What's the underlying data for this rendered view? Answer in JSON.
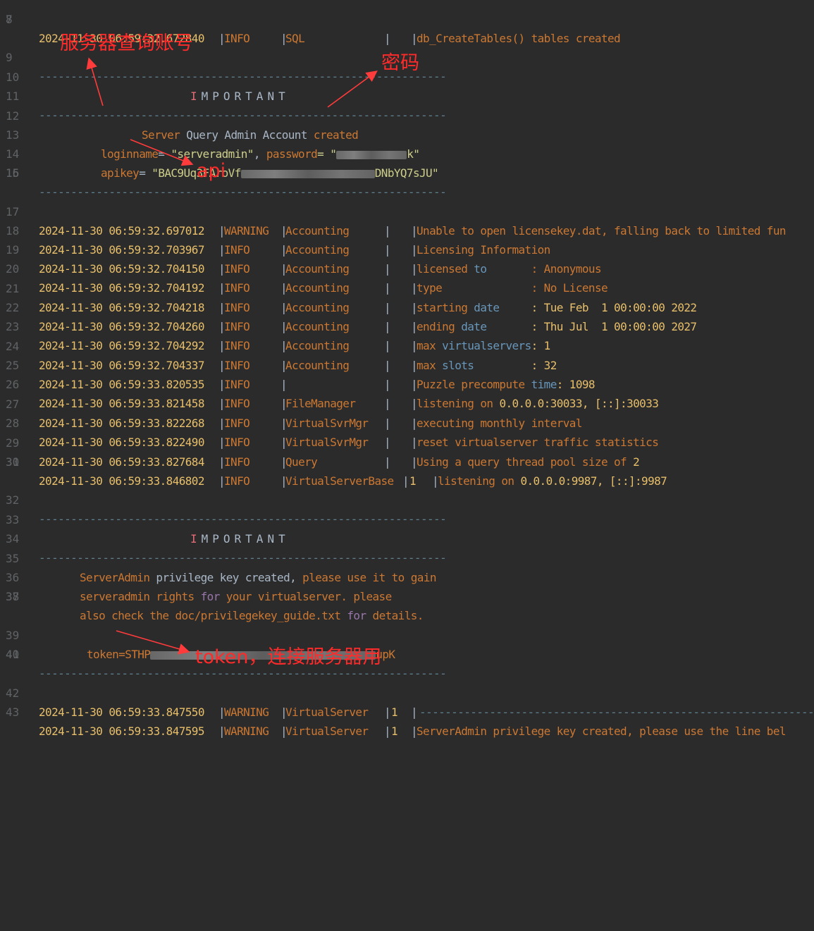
{
  "lines": {
    "l7": {
      "num": "7",
      "ts": "2024-11-30 06:59:32.672840",
      "lv": "INFO",
      "mod": "SQL",
      "msg": "db_CreateTables() tables created"
    },
    "l8": {
      "num": "8"
    },
    "l9": {
      "num": "9",
      "sep": "----------------------------------------------------------------"
    },
    "l10": {
      "num": "10",
      "important_first": "I",
      "important_rest": "MPORTANT"
    },
    "l11": {
      "num": "11",
      "sep": "----------------------------------------------------------------"
    },
    "l12": {
      "num": "12",
      "a": "Server",
      "b": " Query Admin Account ",
      "c": "created"
    },
    "l13": {
      "num": "13",
      "a": "loginname",
      "b": "= ",
      "c": "\"serveradmin\"",
      "d": ", ",
      "e": "password",
      "f": "= \"",
      "g": "k\""
    },
    "l14": {
      "num": "14",
      "a": "apikey",
      "b": "= ",
      "c": "\"BAC9Uq3FAroVf",
      "d": "DNbYQ7sJU\""
    },
    "l15": {
      "num": "15",
      "sep": "----------------------------------------------------------------"
    },
    "l16": {
      "num": "16"
    },
    "l17": {
      "num": "17",
      "ts": "2024-11-30 06:59:32.697012",
      "lv": "WARNING",
      "mod": "Accounting",
      "msg": "Unable to open licensekey.dat, falling back to limited fun"
    },
    "l18": {
      "num": "18",
      "ts": "2024-11-30 06:59:32.703967",
      "lv": "INFO",
      "mod": "Accounting",
      "msg": "Licensing Information"
    },
    "l19": {
      "num": "19",
      "ts": "2024-11-30 06:59:32.704150",
      "lv": "INFO",
      "mod": "Accounting",
      "k1": "licensed ",
      "k2": "to",
      "pad": "       ",
      "val": ": Anonymous"
    },
    "l20": {
      "num": "20",
      "ts": "2024-11-30 06:59:32.704192",
      "lv": "INFO",
      "mod": "Accounting",
      "k1": "type",
      "k2": "",
      "pad": "              ",
      "val": ": No License"
    },
    "l21": {
      "num": "21",
      "ts": "2024-11-30 06:59:32.704218",
      "lv": "INFO",
      "mod": "Accounting",
      "k1": "starting ",
      "k2": "date",
      "pad": "     ",
      "val": ": Tue Feb  1 00:00:00 2022"
    },
    "l22": {
      "num": "22",
      "ts": "2024-11-30 06:59:32.704260",
      "lv": "INFO",
      "mod": "Accounting",
      "k1": "ending ",
      "k2": "date",
      "pad": "       ",
      "val": ": Thu Jul  1 00:00:00 2027"
    },
    "l23": {
      "num": "23",
      "ts": "2024-11-30 06:59:32.704292",
      "lv": "INFO",
      "mod": "Accounting",
      "k1": "max ",
      "k2": "virtualservers",
      "pad": "",
      "val": ": 1"
    },
    "l24": {
      "num": "24",
      "ts": "2024-11-30 06:59:32.704337",
      "lv": "INFO",
      "mod": "Accounting",
      "k1": "max ",
      "k2": "slots",
      "pad": "         ",
      "val": ": 32"
    },
    "l25": {
      "num": "25",
      "ts": "2024-11-30 06:59:33.820535",
      "lv": "INFO",
      "mod": "",
      "m1": "Puzzle precompute ",
      "m2": "time",
      "m3": ": 1098"
    },
    "l26": {
      "num": "26",
      "ts": "2024-11-30 06:59:33.821458",
      "lv": "INFO",
      "mod": "FileManager",
      "m1": "listening on ",
      "m2": "0.0.0.0:30033, [::]:30033"
    },
    "l27": {
      "num": "27",
      "ts": "2024-11-30 06:59:33.822268",
      "lv": "INFO",
      "mod": "VirtualSvrMgr",
      "msg": "executing monthly interval"
    },
    "l28": {
      "num": "28",
      "ts": "2024-11-30 06:59:33.822490",
      "lv": "INFO",
      "mod": "VirtualSvrMgr",
      "msg": "reset virtualserver traffic statistics"
    },
    "l29": {
      "num": "29",
      "ts": "2024-11-30 06:59:33.827684",
      "lv": "INFO",
      "mod": "Query",
      "m1": "Using a query thread pool size of ",
      "m2": "2"
    },
    "l30": {
      "num": "30",
      "ts": "2024-11-30 06:59:33.846802",
      "lv": "INFO",
      "mod": "VirtualServerBase",
      "sid": "1",
      "m1": "listening on ",
      "m2": "0.0.0.0:9987, [::]:9987"
    },
    "l31": {
      "num": "31"
    },
    "l32": {
      "num": "32",
      "sep": "----------------------------------------------------------------"
    },
    "l33": {
      "num": "33",
      "important_first": "I",
      "important_rest": "MPORTANT"
    },
    "l34": {
      "num": "34",
      "sep": "----------------------------------------------------------------"
    },
    "l35": {
      "num": "35",
      "a": "ServerAdmin",
      "b": " privilege key created, ",
      "c": "please use it to gain"
    },
    "l36": {
      "num": "36",
      "a": "serveradmin rights ",
      "b": "for",
      "c": " your virtualserver. please"
    },
    "l37": {
      "num": "37",
      "a": "also check the doc/privilegekey_guide.txt ",
      "b": "for",
      "c": " details."
    },
    "l38": {
      "num": "38"
    },
    "l39": {
      "num": "39",
      "a": "token=STHP",
      "b": "upK"
    },
    "l40": {
      "num": "40",
      "sep": "----------------------------------------------------------------"
    },
    "l41": {
      "num": "41"
    },
    "l42": {
      "num": "42",
      "ts": "2024-11-30 06:59:33.847550",
      "lv": "WARNING",
      "mod": "VirtualServer",
      "sid": "1",
      "sep": "----------------------------------------------------------------"
    },
    "l43": {
      "num": "43",
      "ts": "2024-11-30 06:59:33.847595",
      "lv": "WARNING",
      "mod": "VirtualServer",
      "sid": "1",
      "msg": "ServerAdmin privilege key created, please use the line bel"
    }
  },
  "annotations": {
    "account": "服务器查询账号",
    "password": "密码",
    "api": "api",
    "token": "token，连接服务器用"
  },
  "colors": {
    "background": "#2b2b2b",
    "annotation": "#ff2a2a",
    "timestamp": "#e8bf6a",
    "keyword": "#cc7832",
    "number": "#6897bb"
  }
}
